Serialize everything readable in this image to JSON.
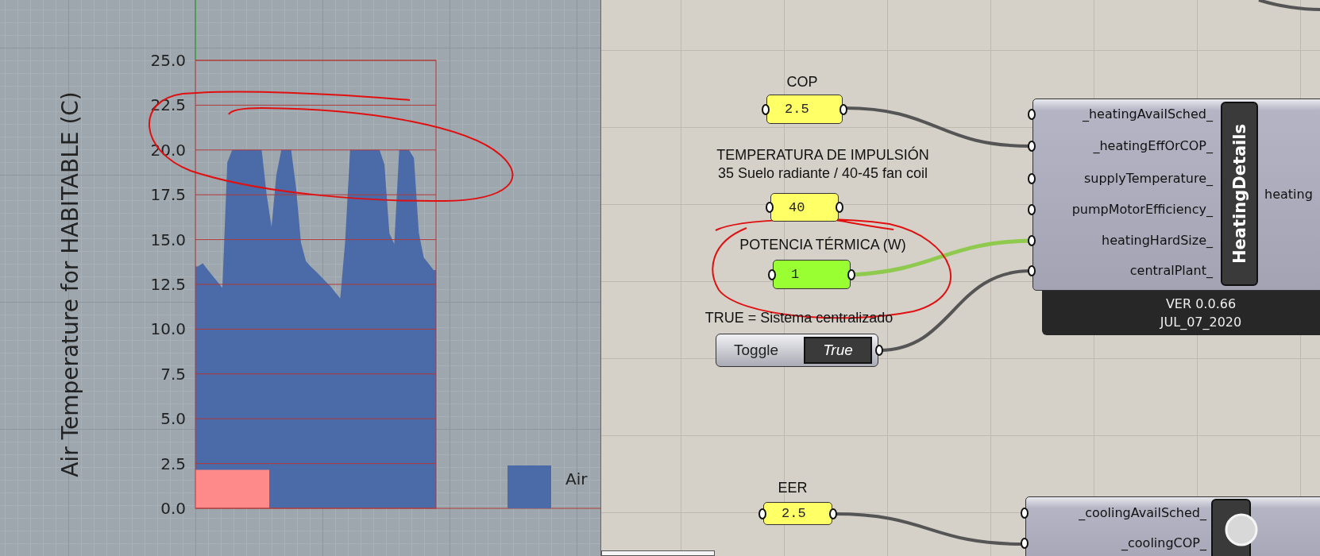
{
  "viewport": {
    "chart_data": {
      "type": "area",
      "ylabel": "Air Temperature for HABITABLE (C)",
      "categories": [
        null,
        null,
        null,
        null,
        null,
        null,
        null,
        null,
        null,
        null,
        null,
        null,
        null,
        null,
        null,
        null,
        null,
        null,
        null,
        null,
        null,
        null,
        null,
        null,
        null,
        null,
        null,
        null,
        null,
        null,
        null,
        null,
        null,
        null,
        null,
        null,
        null,
        null,
        null,
        null,
        null,
        null,
        null,
        null,
        null,
        null,
        null,
        null,
        null
      ],
      "series": [
        {
          "name": "Air",
          "color": "#4a6aa8",
          "values": [
            13.5,
            13.67,
            13.32,
            12.98,
            12.64,
            12.3,
            19.3,
            20,
            20,
            20,
            20,
            20,
            20,
            20,
            17.53,
            15.7,
            18.62,
            20,
            20,
            20,
            17.9,
            14.83,
            13.8,
            13.49,
            13.23,
            12.95,
            12.67,
            12.4,
            12.05,
            11.71,
            14.9,
            20,
            20,
            20,
            20,
            20,
            20,
            20,
            19.18,
            15.35,
            14.75,
            20,
            20,
            20,
            19.55,
            15.36,
            14,
            13.65,
            13.3
          ]
        }
      ],
      "ylim": [
        0,
        25
      ],
      "grid": true,
      "yticks": [
        {
          "value": 0,
          "label": "0.0"
        },
        {
          "value": 2.5,
          "label": "2.5"
        },
        {
          "value": 5,
          "label": "5.0"
        },
        {
          "value": 7.5,
          "label": "7.5"
        },
        {
          "value": 10,
          "label": "10.0"
        },
        {
          "value": 12.5,
          "label": "12.5"
        },
        {
          "value": 15,
          "label": "15.0"
        },
        {
          "value": 17.5,
          "label": "17.5"
        },
        {
          "value": 20,
          "label": "20.0"
        },
        {
          "value": 22.5,
          "label": "22.5"
        },
        {
          "value": 25,
          "label": "25.0"
        }
      ]
    }
  },
  "canvas": {
    "panels": [
      {
        "label_lines": [
          "COP"
        ],
        "value": "2.5",
        "color": "#ffff66"
      },
      {
        "label_lines": [
          "TEMPERATURA DE IMPULSIÓN",
          "35 Suelo radiante / 40-45 fan coil"
        ],
        "value": "40",
        "color": "#ffff66"
      },
      {
        "label_lines": [
          "POTENCIA TÉRMICA (W)"
        ],
        "value": "1",
        "color": "#99ff33"
      },
      {
        "label_lines": [
          "EER"
        ],
        "value": "2.5",
        "color": "#ffff66"
      }
    ],
    "toggle": {
      "caption": "TRUE = Sistema centralizado",
      "name": "Toggle",
      "value": "True",
      "on": true
    },
    "components": [
      {
        "inputs": [
          "_heatingAvailSched_",
          "_heatingEffOrCOP_",
          "supplyTemperature_",
          "pumpMotorEfficiency_",
          "heatingHardSize_",
          "centralPlant_"
        ],
        "title": "HeatingDetails",
        "outputs": [
          "heating"
        ],
        "footer": [
          "VER 0.0.66",
          "JUL_07_2020"
        ]
      },
      {
        "inputs": [
          "_coolingAvailSched_",
          "_coolingCOP_"
        ]
      }
    ]
  }
}
